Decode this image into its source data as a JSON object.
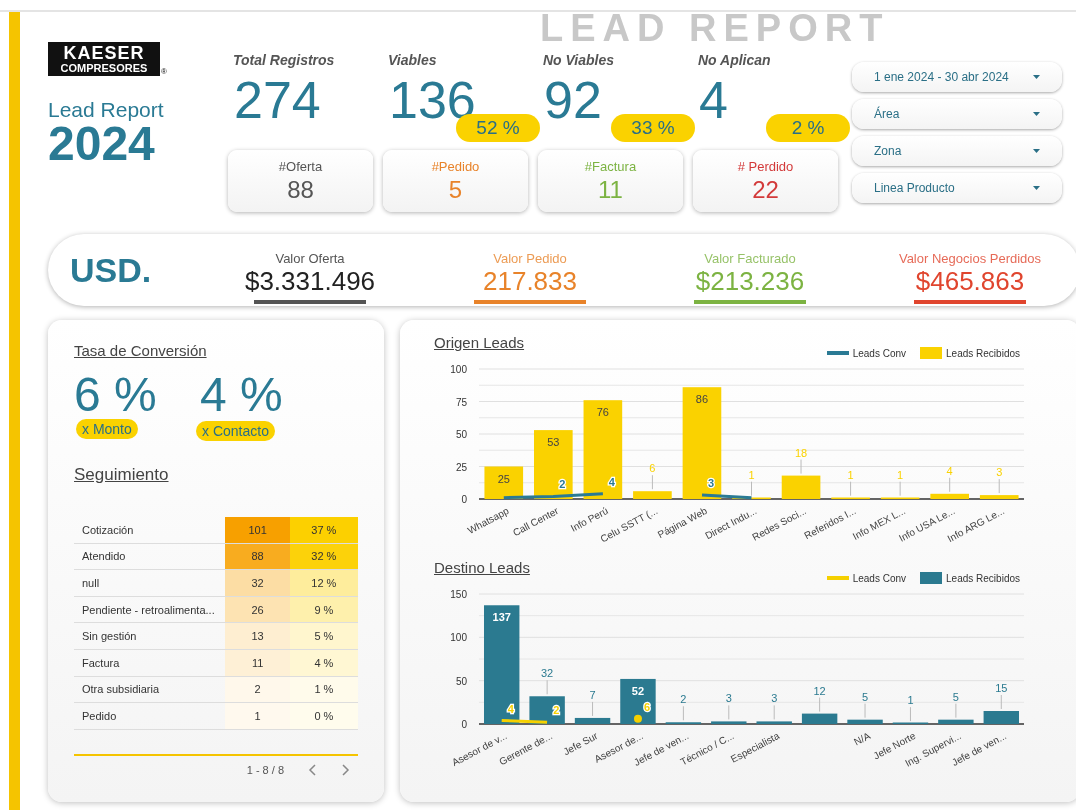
{
  "header": {
    "background_title": "LEAD REPORT",
    "logo": {
      "line_1": "KAESER",
      "line_2": "COMPRESORES",
      "mark": "®"
    },
    "title": "Lead Report",
    "year": "2024"
  },
  "kpis": [
    {
      "label": "Total Registros",
      "value": "274"
    },
    {
      "label": "Viables",
      "value": "136",
      "percent": "52 %"
    },
    {
      "label": "No Viables",
      "value": "92",
      "percent": "33 %"
    },
    {
      "label": "No Aplican",
      "value": "4",
      "percent": "2 %"
    }
  ],
  "counters": [
    {
      "label": "#Oferta",
      "value": "88",
      "color": "#555555"
    },
    {
      "label": "#Pedido",
      "value": "5",
      "color": "#e8832a"
    },
    {
      "label": "#Factura",
      "value": "11",
      "color": "#7cb342"
    },
    {
      "label": "# Perdido",
      "value": "22",
      "color": "#d33a3a"
    }
  ],
  "filters": [
    "1 ene 2024 - 30 abr 2024",
    "Área",
    "Zona",
    "Linea Producto"
  ],
  "currency_band": {
    "currency": "USD.",
    "values": [
      {
        "label": "Valor Oferta",
        "value": "$3.331.496",
        "color": "#555555"
      },
      {
        "label": "Valor Pedido",
        "value": "217.833",
        "color": "#e8832a"
      },
      {
        "label": "Valor Facturado",
        "value": "$213.236",
        "color": "#7cb342"
      },
      {
        "label": "Valor Negocios Perdidos",
        "value": "$465.863",
        "color": "#e0452e"
      }
    ]
  },
  "conversion": {
    "title": "Tasa de Conversión",
    "rates": [
      {
        "value": "6 %",
        "label": "x Monto"
      },
      {
        "value": "4 %",
        "label": "x Contacto"
      }
    ]
  },
  "follow_up": {
    "title": "Seguimiento",
    "rows": [
      {
        "name": "Cotización",
        "count": "101",
        "percent": "37 %"
      },
      {
        "name": "Atendido",
        "count": "88",
        "percent": "32 %"
      },
      {
        "name": "null",
        "count": "32",
        "percent": "12 %"
      },
      {
        "name": "Pendiente - retroalimenta...",
        "count": "26",
        "percent": "9 %"
      },
      {
        "name": "Sin gestión",
        "count": "13",
        "percent": "5 %"
      },
      {
        "name": "Factura",
        "count": "11",
        "percent": "4 %"
      },
      {
        "name": "Otra subsidiaria",
        "count": "2",
        "percent": "1 %"
      },
      {
        "name": "Pedido",
        "count": "1",
        "percent": "0 %"
      }
    ],
    "pagination": "1 - 8 / 8"
  },
  "origin_leads": {
    "title": "Origen Leads",
    "chart_data": {
      "type": "bar",
      "categories": [
        "Whatsapp",
        "Call Center",
        "Info Perú",
        "Celu SSTT (...",
        "Página Web",
        "Direct Indu...",
        "Redes Soci...",
        "Referidos I...",
        "Info MEX L...",
        "Info USA Le...",
        "Info ARG Le..."
      ],
      "series": [
        {
          "name": "Leads Conv",
          "type": "line",
          "color": "#2a7a94",
          "values": [
            1,
            2,
            4,
            null,
            3,
            1,
            null,
            null,
            null,
            null,
            null
          ],
          "value_labels": [
            null,
            "2",
            "4",
            null,
            "3",
            null,
            null,
            null,
            null,
            null,
            null
          ]
        },
        {
          "name": "Leads Recibidos",
          "type": "bar",
          "color": "#fad200",
          "values": [
            25,
            53,
            76,
            6,
            86,
            1,
            18,
            1,
            1,
            4,
            3
          ],
          "value_labels": [
            "25",
            "53",
            "76",
            "6",
            "86",
            "1",
            "18",
            "1",
            "1",
            "4",
            "3"
          ]
        }
      ],
      "ylim": [
        0,
        100
      ],
      "yticks": [
        0,
        25,
        50,
        75,
        100
      ],
      "grid": true
    }
  },
  "destino_leads": {
    "title": "Destino Leads",
    "chart_data": {
      "type": "bar",
      "categories": [
        "Asesor de v...",
        "Gerente de...",
        "Jefe Sur",
        "Asesor de...",
        "Jefe de ven...",
        "Técnico / C...",
        "Especialista",
        null,
        "N/A",
        "Jefe Norte",
        "Ing. Supervi...",
        "Jefe de ven..."
      ],
      "series": [
        {
          "name": "Leads Conv",
          "type": "line",
          "color": "#f5d000",
          "values": [
            4,
            2,
            null,
            6,
            null,
            null,
            null,
            null,
            null,
            null,
            null,
            null
          ],
          "value_labels": [
            "4",
            "2",
            null,
            "6",
            null,
            null,
            null,
            null,
            null,
            null,
            null,
            null
          ]
        },
        {
          "name": "Leads Recibidos",
          "type": "bar",
          "color": "#2b7a90",
          "values": [
            137,
            32,
            7,
            52,
            2,
            3,
            3,
            12,
            5,
            1,
            5,
            15
          ],
          "value_labels": [
            "137",
            "32",
            "7",
            "52",
            "2",
            "3",
            "3",
            "12",
            "5",
            "1",
            "5",
            "15"
          ]
        }
      ],
      "ylim": [
        0,
        150
      ],
      "yticks": [
        0,
        50,
        100,
        150
      ],
      "grid": true
    }
  }
}
